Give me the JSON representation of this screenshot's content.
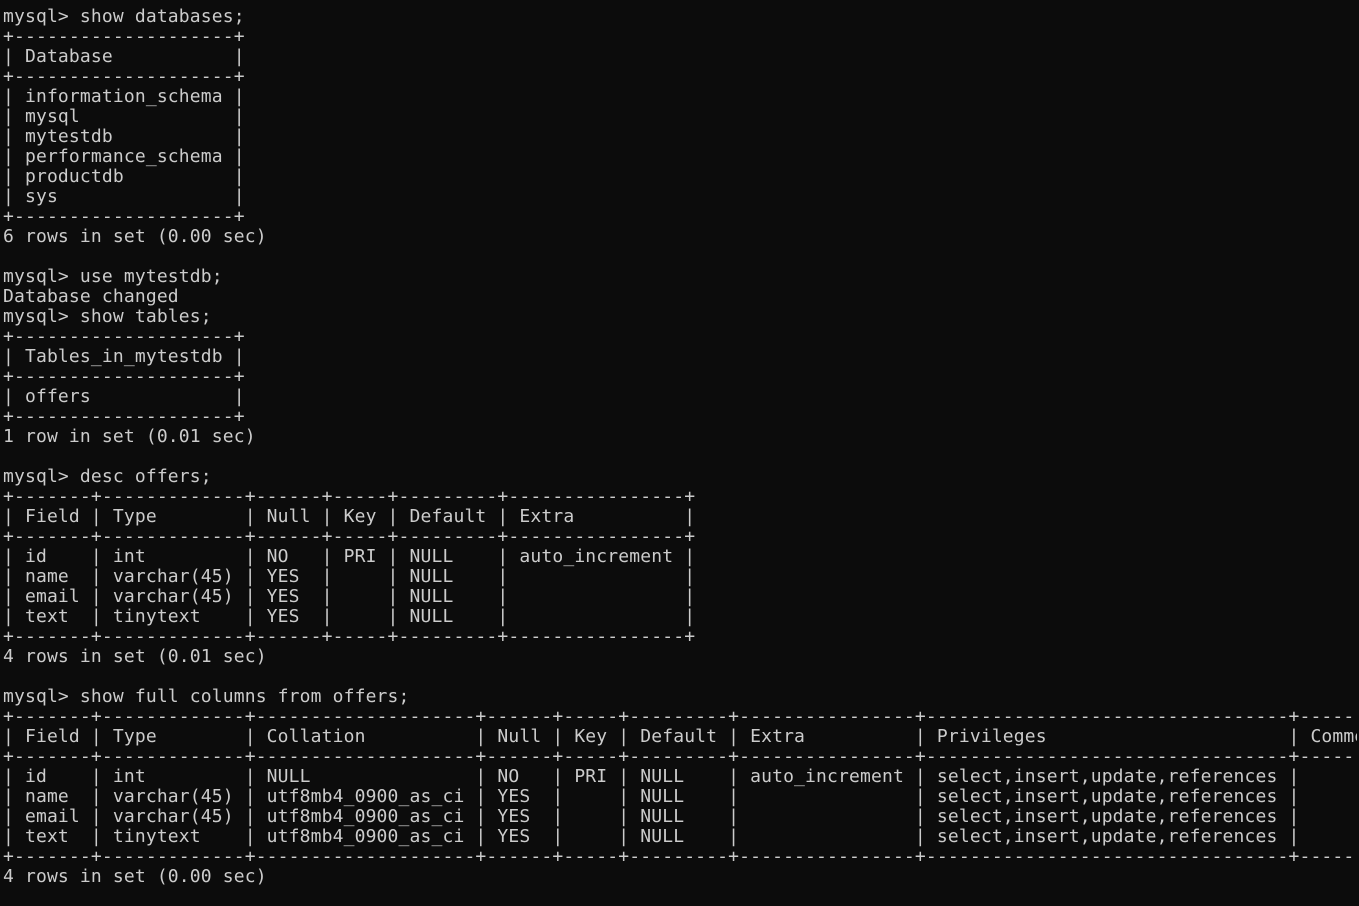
{
  "terminal": {
    "text_color": "#cccccc",
    "background": "#0c0c0c",
    "lines": [
      "mysql> show databases;",
      "+--------------------+",
      "| Database           |",
      "+--------------------+",
      "| information_schema |",
      "| mysql              |",
      "| mytestdb           |",
      "| performance_schema |",
      "| productdb          |",
      "| sys                |",
      "+--------------------+",
      "6 rows in set (0.00 sec)",
      "",
      "mysql> use mytestdb;",
      "Database changed",
      "mysql> show tables;",
      "+--------------------+",
      "| Tables_in_mytestdb |",
      "+--------------------+",
      "| offers             |",
      "+--------------------+",
      "1 row in set (0.01 sec)",
      "",
      "mysql> desc offers;",
      "+-------+-------------+------+-----+---------+----------------+",
      "| Field | Type        | Null | Key | Default | Extra          |",
      "+-------+-------------+------+-----+---------+----------------+",
      "| id    | int         | NO   | PRI | NULL    | auto_increment |",
      "| name  | varchar(45) | YES  |     | NULL    |                |",
      "| email | varchar(45) | YES  |     | NULL    |                |",
      "| text  | tinytext    | YES  |     | NULL    |                |",
      "+-------+-------------+------+-----+---------+----------------+",
      "4 rows in set (0.01 sec)",
      "",
      "mysql> show full columns from offers;",
      "+-------+-------------+--------------------+------+-----+---------+----------------+---------------------------------+---------+",
      "| Field | Type        | Collation          | Null | Key | Default | Extra          | Privileges                      | Comment |",
      "+-------+-------------+--------------------+------+-----+---------+----------------+---------------------------------+---------+",
      "| id    | int         | NULL               | NO   | PRI | NULL    | auto_increment | select,insert,update,references |         |",
      "| name  | varchar(45) | utf8mb4_0900_as_ci | YES  |     | NULL    |                | select,insert,update,references |         |",
      "| email | varchar(45) | utf8mb4_0900_as_ci | YES  |     | NULL    |                | select,insert,update,references |         |",
      "| text  | tinytext    | utf8mb4_0900_as_ci | YES  |     | NULL    |                | select,insert,update,references |         |",
      "+-------+-------------+--------------------+------+-----+---------+----------------+---------------------------------+---------+",
      "4 rows in set (0.00 sec)"
    ]
  }
}
